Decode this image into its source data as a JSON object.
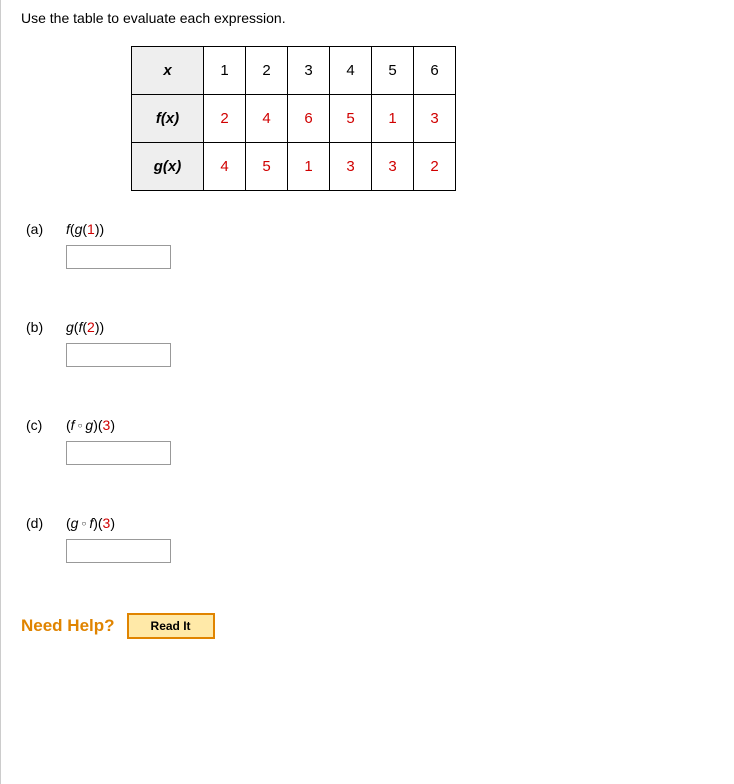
{
  "instruction": "Use the table to evaluate each expression.",
  "table": {
    "row0": {
      "label": "x",
      "c1": "1",
      "c2": "2",
      "c3": "3",
      "c4": "4",
      "c5": "5",
      "c6": "6"
    },
    "row1": {
      "label": "f(x)",
      "c1": "2",
      "c2": "4",
      "c3": "6",
      "c4": "5",
      "c5": "1",
      "c6": "3"
    },
    "row2": {
      "label": "g(x)",
      "c1": "4",
      "c2": "5",
      "c3": "1",
      "c4": "3",
      "c5": "3",
      "c6": "2"
    }
  },
  "parts": {
    "a": {
      "label": "(a)",
      "expr_prefix1": "f",
      "expr_open1": "(",
      "expr_prefix2": "g",
      "expr_open2": "(",
      "arg": "1",
      "expr_close": "))"
    },
    "b": {
      "label": "(b)",
      "expr_prefix1": "g",
      "expr_open1": "(",
      "expr_prefix2": "f",
      "expr_open2": "(",
      "arg": "2",
      "expr_close": "))"
    },
    "c": {
      "label": "(c)",
      "open": "(",
      "fn1": "f",
      "fn2": "g",
      "close": ")(",
      "arg": "3",
      "close2": ")"
    },
    "d": {
      "label": "(d)",
      "open": "(",
      "fn1": "g",
      "fn2": "f",
      "close": ")(",
      "arg": "3",
      "close2": ")"
    }
  },
  "help": {
    "label": "Need Help?",
    "read": "Read It"
  },
  "chart_data": {
    "type": "table",
    "columns": [
      "x",
      "1",
      "2",
      "3",
      "4",
      "5",
      "6"
    ],
    "rows": [
      [
        "f(x)",
        2,
        4,
        6,
        5,
        1,
        3
      ],
      [
        "g(x)",
        4,
        5,
        1,
        3,
        3,
        2
      ]
    ]
  }
}
